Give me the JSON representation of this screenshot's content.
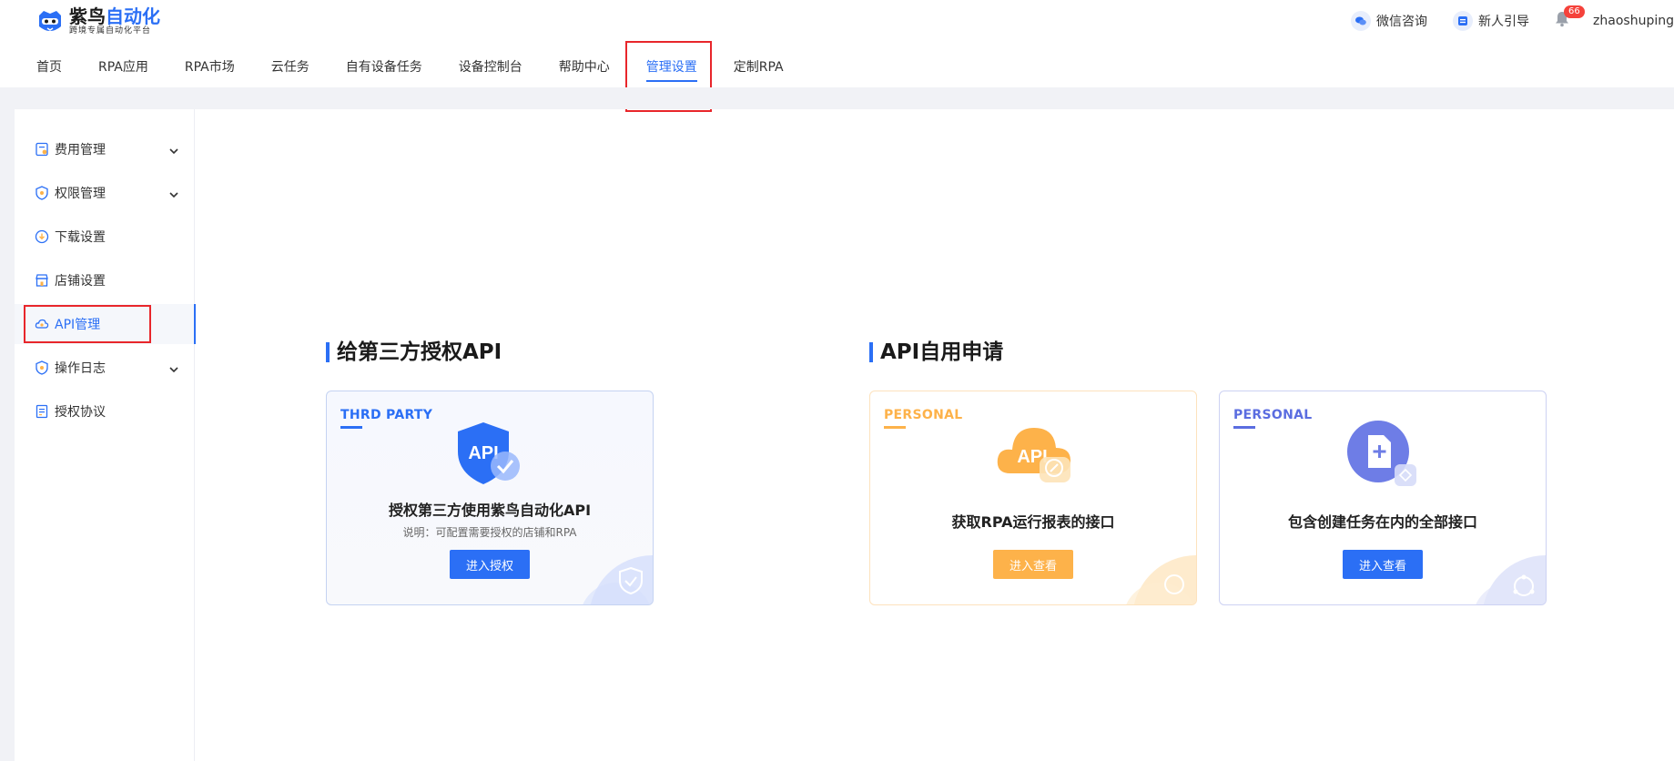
{
  "brand": {
    "name_part1": "紫鸟",
    "name_part2": "自动化",
    "subtitle": "跨境专属自动化平台"
  },
  "header": {
    "wechat_label": "微信咨询",
    "guide_label": "新人引导",
    "notification_count": "66",
    "username": "zhaoshuping"
  },
  "nav": {
    "items": [
      {
        "label": "首页"
      },
      {
        "label": "RPA应用"
      },
      {
        "label": "RPA市场"
      },
      {
        "label": "云任务"
      },
      {
        "label": "自有设备任务"
      },
      {
        "label": "设备控制台"
      },
      {
        "label": "帮助中心"
      },
      {
        "label": "管理设置"
      },
      {
        "label": "定制RPA"
      }
    ],
    "active_index": 7
  },
  "sidebar": {
    "items": [
      {
        "label": "费用管理",
        "icon": "fee-icon",
        "expandable": true
      },
      {
        "label": "权限管理",
        "icon": "shield-icon",
        "expandable": true
      },
      {
        "label": "下载设置",
        "icon": "download-icon",
        "expandable": false
      },
      {
        "label": "店铺设置",
        "icon": "store-icon",
        "expandable": false
      },
      {
        "label": "API管理",
        "icon": "cloud-icon",
        "expandable": false
      },
      {
        "label": "操作日志",
        "icon": "log-shield-icon",
        "expandable": true
      },
      {
        "label": "授权协议",
        "icon": "document-icon",
        "expandable": false
      }
    ],
    "active_index": 4
  },
  "sections": {
    "third_party_title": "给第三方授权API",
    "self_use_title": "API自用申请"
  },
  "cards": [
    {
      "tag": "THRD PARTY",
      "icon_text": "API",
      "title": "授权第三方使用紫鸟自动化API",
      "desc": "说明：可配置需要授权的店铺和RPA",
      "button": "进入授权",
      "accent": "#2b6ff5"
    },
    {
      "tag": "PERSONAL",
      "icon_text": "API",
      "title": "获取RPA运行报表的接口",
      "desc": "",
      "button": "进入查看",
      "accent": "#fdb24a"
    },
    {
      "tag": "PERSONAL",
      "icon_text": "",
      "title": "包含创建任务在内的全部接口",
      "desc": "",
      "button": "进入查看",
      "accent": "#5b6de0"
    }
  ],
  "colors": {
    "primary": "#2b6ff5",
    "orange": "#fdb24a",
    "indigo": "#5b6de0",
    "highlight_box": "#e8262b",
    "badge": "#f5423b"
  }
}
